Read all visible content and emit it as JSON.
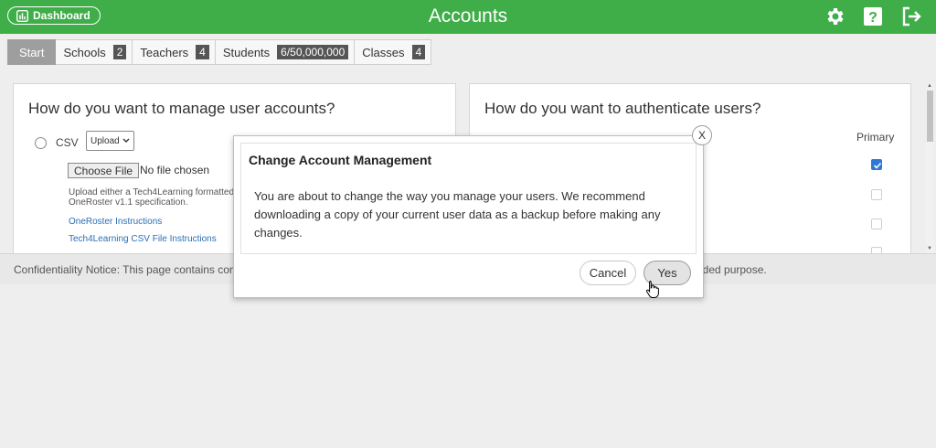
{
  "header": {
    "dashboard_label": "Dashboard",
    "title": "Accounts",
    "icons": [
      "bar-chart-icon",
      "gear-icon",
      "help-icon",
      "logout-icon"
    ]
  },
  "tabs": [
    {
      "label": "Start",
      "badge": null,
      "active": true
    },
    {
      "label": "Schools",
      "badge": "2"
    },
    {
      "label": "Teachers",
      "badge": "4"
    },
    {
      "label": "Students",
      "badge": "6/50,000,000"
    },
    {
      "label": "Classes",
      "badge": "4"
    }
  ],
  "left_panel": {
    "heading": "How do you want to manage user accounts?",
    "csv_label": "CSV",
    "select_value": "Upload",
    "file_button": "Choose File",
    "file_status": "No file chosen",
    "help_text_1": "Upload either a Tech4Learning formatted",
    "help_text_2": "OneRoster v1.1 specification.",
    "link_1": "OneRoster Instructions",
    "link_2": "Tech4Learning CSV File Instructions"
  },
  "right_panel": {
    "heading": "How do you want to authenticate users?",
    "primary_label": "Primary"
  },
  "notice": {
    "left": "Confidentiality Notice: This page contains con",
    "right": "nded purpose."
  },
  "modal": {
    "title": "Change Account Management",
    "body": "You are about to change the way you manage your users. We recommend downloading a copy of your current user data as a backup before making any changes.",
    "close": "X",
    "cancel": "Cancel",
    "yes": "Yes"
  },
  "colors": {
    "header_green": "#3fae49",
    "checkbox_blue": "#2f78d5",
    "link_blue": "#2a6fb5"
  }
}
